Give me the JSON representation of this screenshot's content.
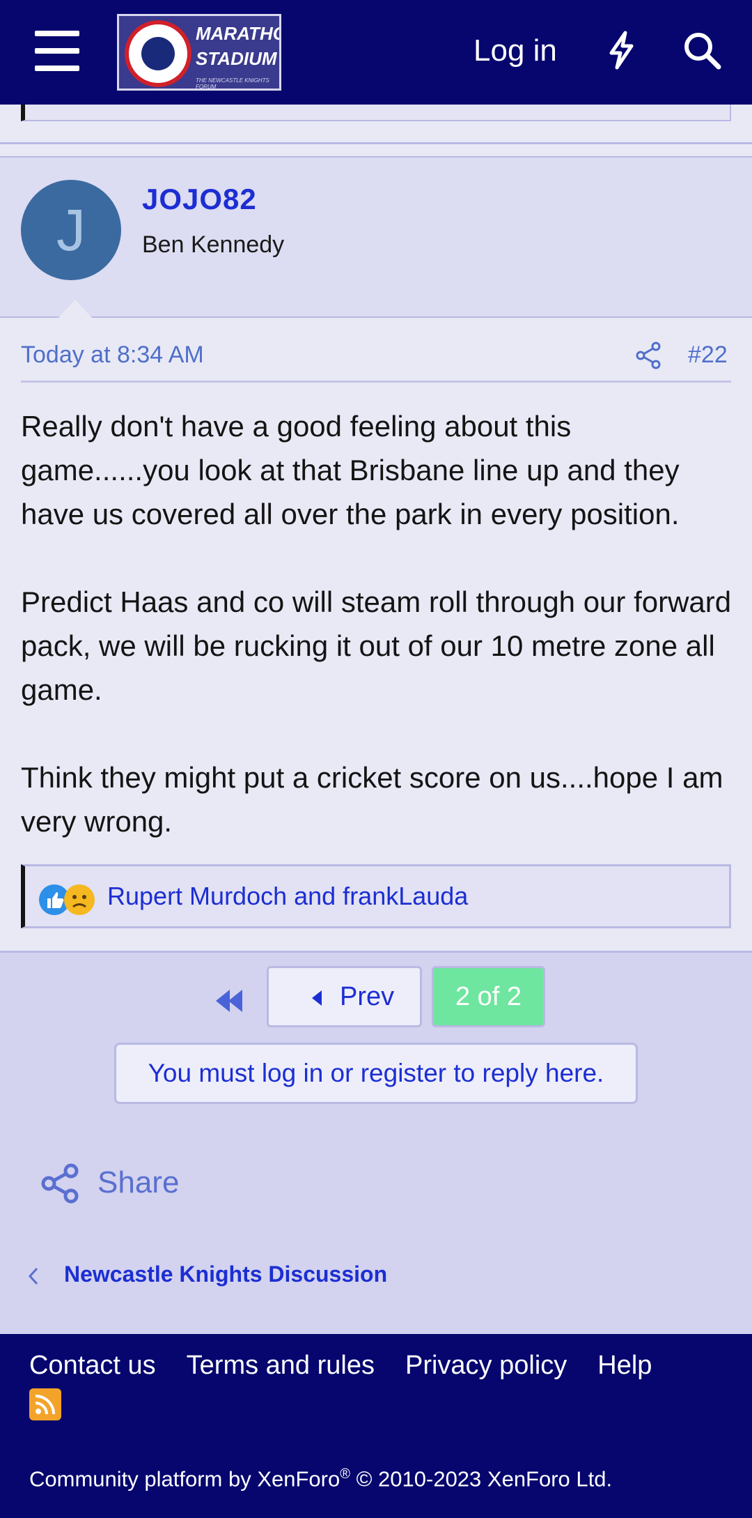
{
  "header": {
    "logo_line1": "MARATHON",
    "logo_line2": "STADIUM",
    "logo_tagline": "THE NEWCASTLE KNIGHTS FORUM",
    "login_label": "Log in"
  },
  "post": {
    "avatar_letter": "J",
    "username": "JOJO82",
    "user_title": "Ben Kennedy",
    "date": "Today at 8:34 AM",
    "number": "#22",
    "paragraphs": [
      "Really don't have a good feeling about this game......you look at that Brisbane line up and they have us covered all over the park in every position.",
      "Predict Haas and co will steam roll through our forward pack, we will be rucking it out of our 10 metre zone all game.",
      "Think they might put a cricket score on us....hope I am very wrong."
    ],
    "reactions_text": "Rupert Murdoch and frankLauda"
  },
  "pagination": {
    "prev_label": "Prev",
    "current_page": "2 of 2"
  },
  "reply_notice": "You must log in or register to reply here.",
  "share_label": "Share",
  "breadcrumb": "Newcastle Knights Discussion",
  "footer": {
    "links": [
      "Contact us",
      "Terms and rules",
      "Privacy policy",
      "Help"
    ],
    "copyright_prefix": "Community platform by XenForo",
    "copyright_reg": "®",
    "copyright_suffix": " © 2010-2023 XenForo Ltd."
  },
  "colors": {
    "header_bg": "#06066e",
    "link": "#1c2ed2",
    "page_current": "#6ee6a0"
  }
}
